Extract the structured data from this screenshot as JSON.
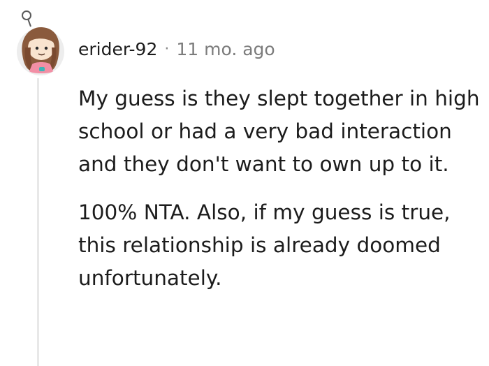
{
  "comment": {
    "username": "erider-92",
    "separator": "·",
    "timestamp": "11 mo. ago",
    "avatar_icon": "snoo-avatar-icon",
    "paragraphs": [
      "My guess is they slept together in high school or had a very bad interaction and they don't want to own up to it.",
      "100% NTA. Also, if my guess is true, this relationship is already doomed unfortunately."
    ]
  },
  "colors": {
    "text": "#1c1c1c",
    "meta": "#7c7c7c",
    "thread_line": "#e8e8e8",
    "avatar_background": "#ededed"
  }
}
